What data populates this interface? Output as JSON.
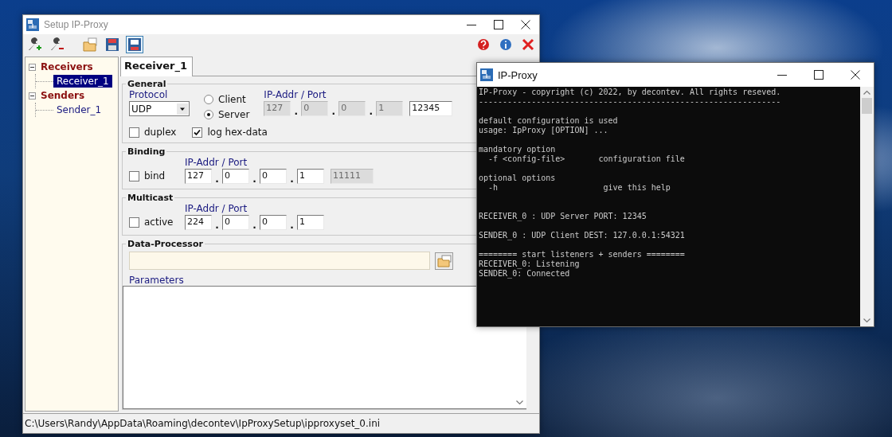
{
  "setup_window": {
    "title": "Setup IP-Proxy",
    "tree": [
      {
        "label": "Receivers",
        "expanded": true,
        "selected": false,
        "children": [
          {
            "label": "Receiver_1",
            "selected": true
          }
        ]
      },
      {
        "label": "Senders",
        "expanded": true,
        "selected": false,
        "children": [
          {
            "label": "Sender_1",
            "selected": false
          }
        ]
      }
    ],
    "tabs": [
      {
        "label": "Receiver_1",
        "selected": true
      }
    ],
    "general": {
      "title": "General",
      "protocol_label": "Protocol",
      "protocol_value": "UDP",
      "modes": [
        {
          "label": "Client",
          "selected": false
        },
        {
          "label": "Server",
          "selected": true
        }
      ],
      "address_label": "IP-Addr / Port",
      "separator": ".",
      "address": [
        {
          "value": "127",
          "disabled": true
        },
        {
          "value": "0",
          "disabled": true
        },
        {
          "value": "0",
          "disabled": true
        },
        {
          "value": "1",
          "disabled": true
        }
      ],
      "port": {
        "value": "12345",
        "disabled": false
      },
      "options": [
        {
          "label": "duplex",
          "checked": false
        },
        {
          "label": "log hex-data",
          "checked": true
        }
      ]
    },
    "binding": {
      "title": "Binding",
      "option": {
        "label": "bind",
        "checked": false
      },
      "address_label": "IP-Addr / Port",
      "separator": ".",
      "address": [
        {
          "value": "127",
          "disabled": false
        },
        {
          "value": "0",
          "disabled": false
        },
        {
          "value": "0",
          "disabled": false
        },
        {
          "value": "1",
          "disabled": false
        }
      ],
      "port": {
        "value": "11111",
        "disabled": true
      }
    },
    "multicast": {
      "title": "Multicast",
      "option": {
        "label": "active",
        "checked": false
      },
      "address_label": "IP-Addr / Port",
      "separator": ".",
      "address": [
        {
          "value": "224",
          "disabled": false
        },
        {
          "value": "0",
          "disabled": false
        },
        {
          "value": "0",
          "disabled": false
        },
        {
          "value": "1",
          "disabled": false
        }
      ]
    },
    "data_processor": {
      "title": "Data-Processor",
      "parameters_label": "Parameters"
    },
    "status_bar": "C:\\Users\\Randy\\AppData\\Roaming\\decontev\\IpProxySetup\\ipproxyset_0.ini"
  },
  "console_window": {
    "title": "IP-Proxy",
    "sections": [
      {
        "blocks": [
          {
            "lines": [
              "IP-Proxy - copyright (c) 2022, by decontev. All rights reseved.",
              "---------------------------------------------------------------"
            ]
          },
          {
            "lines": [
              "default configuration is used",
              "usage: IpProxy [OPTION] ..."
            ]
          },
          {
            "lines": [
              "mandatory option",
              "  -f <config-file>       configuration file"
            ]
          },
          {
            "lines": [
              "optional options",
              "  -h                      give this help"
            ]
          }
        ]
      },
      {
        "blocks": [
          {
            "lines": [
              "RECEIVER_0 : UDP Server PORT: 12345"
            ]
          },
          {
            "lines": [
              "SENDER_0 : UDP Client DEST: 127.0.0.1:54321"
            ]
          },
          {
            "lines": [
              "======== start listeners + senders ========",
              "RECEIVER_0: Listening",
              "SENDER_0: Connected"
            ]
          }
        ]
      }
    ]
  }
}
